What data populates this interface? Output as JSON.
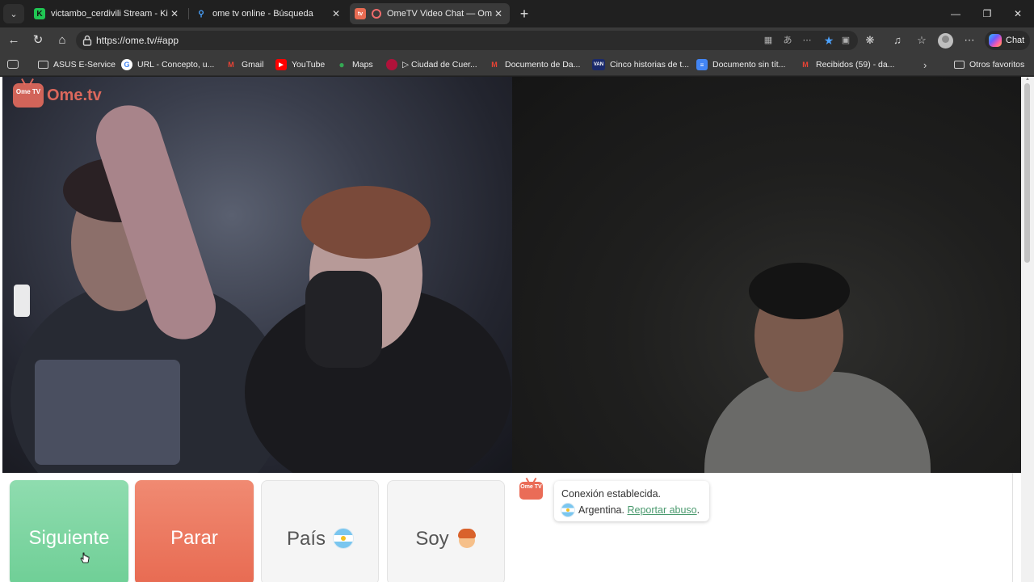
{
  "browser": {
    "tabs": [
      {
        "title": "victambo_cerdivili Stream - Kick D",
        "favicon": "kick-icon",
        "active": false
      },
      {
        "title": "ome tv online - Búsqueda",
        "favicon": "search-icon",
        "active": false
      },
      {
        "title": "OmeTV Video Chat — Omegl",
        "favicon": "ometv-icon",
        "active": true
      }
    ],
    "url": "https://ome.tv/#app",
    "chat_button_label": "Chat",
    "bookmarks": [
      {
        "label": "ASUS E-Service",
        "icon": "folder-icon"
      },
      {
        "label": "URL - Concepto, u...",
        "icon": "google-icon"
      },
      {
        "label": "Gmail",
        "icon": "gmail-icon"
      },
      {
        "label": "YouTube",
        "icon": "youtube-icon"
      },
      {
        "label": "Maps",
        "icon": "maps-icon"
      },
      {
        "label": "▷ Ciudad de Cuer...",
        "icon": "site-icon"
      },
      {
        "label": "Documento de Da...",
        "icon": "gmail-icon"
      },
      {
        "label": "Cinco historias de t...",
        "icon": "van-icon"
      },
      {
        "label": "Documento sin tít...",
        "icon": "docs-icon"
      },
      {
        "label": "Recibidos (59) - da...",
        "icon": "gmail-icon"
      }
    ],
    "other_favorites": "Otros favoritos"
  },
  "app": {
    "logo_text": "Ome.tv",
    "logo_badge": "Ome TV",
    "buttons": {
      "next": "Siguiente",
      "stop": "Parar",
      "country": "País",
      "gender": "Soy"
    },
    "chat": {
      "bot_badge": "Ome TV",
      "status": "Conexión establecida.",
      "country": "Argentina.",
      "report_link": "Reportar abuso",
      "report_suffix": "."
    }
  }
}
